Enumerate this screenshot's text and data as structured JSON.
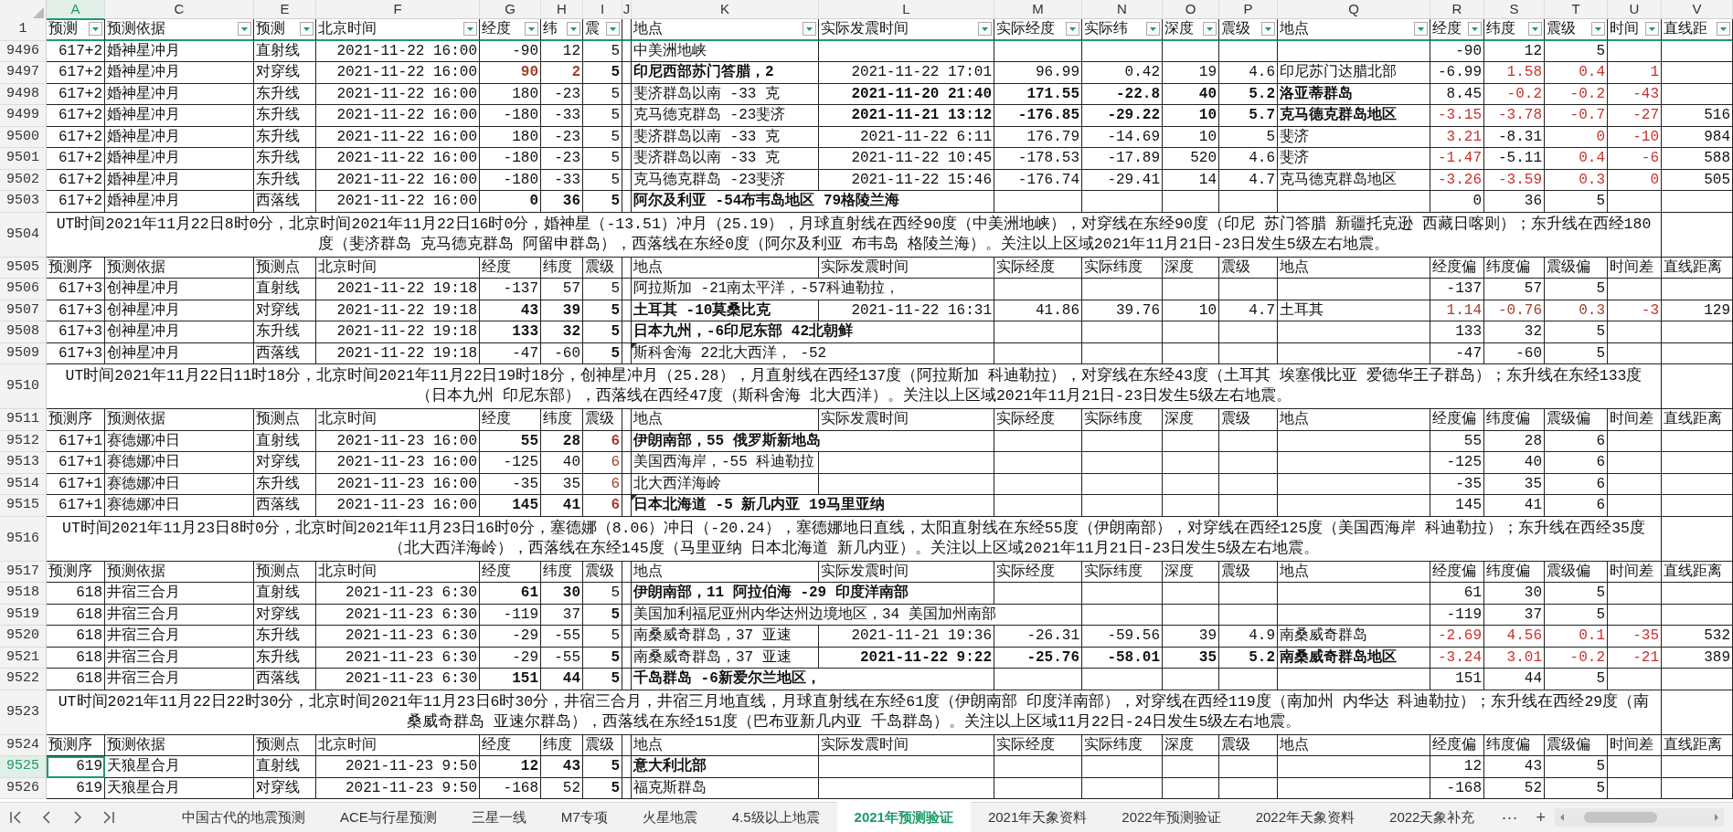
{
  "column_letters": [
    {
      "label": "A",
      "selected": true
    },
    {
      "label": "C",
      "selected": false
    },
    {
      "label": "E",
      "selected": false
    },
    {
      "label": "F",
      "selected": false
    },
    {
      "label": "G",
      "selected": false
    },
    {
      "label": "H",
      "selected": false
    },
    {
      "label": "I",
      "selected": false
    },
    {
      "label": "J",
      "selected": false
    },
    {
      "label": "K",
      "selected": false
    },
    {
      "label": "L",
      "selected": false
    },
    {
      "label": "M",
      "selected": false
    },
    {
      "label": "N",
      "selected": false
    },
    {
      "label": "O",
      "selected": false
    },
    {
      "label": "P",
      "selected": false
    },
    {
      "label": "Q",
      "selected": false
    },
    {
      "label": "R",
      "selected": false
    },
    {
      "label": "S",
      "selected": false
    },
    {
      "label": "T",
      "selected": false
    },
    {
      "label": "U",
      "selected": false
    },
    {
      "label": "V",
      "selected": false
    }
  ],
  "rows": [
    {
      "kind": "filter-header",
      "number": "1",
      "selected": false,
      "cells": {
        "A": "预测",
        "C": "预测依据",
        "E": "预测",
        "F": "北京时间",
        "G": "经度",
        "H": "纬",
        "I": "震",
        "K": "地点",
        "L": "实际发震时间",
        "M": "实际经度",
        "N": "实际纬",
        "O": "深度",
        "P": "震级",
        "Q": "地点",
        "R": "经度",
        "S": "纬度",
        "T": "震级",
        "U": "时间",
        "V": "直线距"
      }
    },
    {
      "kind": "data",
      "number": "9496",
      "selected": false,
      "cells": {
        "A": "617+2",
        "C": "婚神星冲月",
        "E": "直射线",
        "F": "2021-11-22 16:00",
        "G": "-90",
        "H": "12",
        "I": "5",
        "K": "中美洲地峡",
        "R": "-90",
        "S": "12",
        "T": "5"
      }
    },
    {
      "kind": "data",
      "number": "9497",
      "selected": false,
      "cells": {
        "A": "617+2",
        "C": "婚神星冲月",
        "E": "对穿线",
        "F": "2021-11-22 16:00",
        "G": {
          "text": "90",
          "bold": true,
          "color": "#a0402c"
        },
        "H": {
          "text": "2",
          "bold": true,
          "color": "#a0402c"
        },
        "I": {
          "text": "5",
          "bold": true
        },
        "K": {
          "text": "印尼西部苏门答腊，2",
          "bold": true
        },
        "L": "2021-11-22 17:01",
        "M": "96.99",
        "N": "0.42",
        "O": "19",
        "P": "4.6",
        "Q": "印尼苏门达腊北部",
        "R": "-6.99",
        "S": {
          "text": "1.58",
          "color": "#c8322d"
        },
        "T": {
          "text": "0.4",
          "color": "#c8322d"
        },
        "U": {
          "text": "1",
          "color": "#c8322d"
        }
      }
    },
    {
      "kind": "data",
      "number": "9498",
      "selected": false,
      "cells": {
        "A": "617+2",
        "C": "婚神星冲月",
        "E": "东升线",
        "F": "2021-11-22 16:00",
        "G": "180",
        "H": "-23",
        "I": "5",
        "K": "斐济群岛以南 -33 克",
        "L": {
          "text": "2021-11-20 21:40",
          "bold": true
        },
        "M": {
          "text": "171.55",
          "bold": true
        },
        "N": {
          "text": "-22.8",
          "bold": true
        },
        "O": {
          "text": "40",
          "bold": true
        },
        "P": {
          "text": "5.2",
          "bold": true
        },
        "Q": {
          "text": "洛亚蒂群岛",
          "bold": true
        },
        "R": "8.45",
        "S": {
          "text": "-0.2",
          "color": "#c8322d"
        },
        "T": {
          "text": "-0.2",
          "color": "#c8322d"
        },
        "U": {
          "text": "-43",
          "color": "#c8322d"
        }
      }
    },
    {
      "kind": "data",
      "number": "9499",
      "selected": false,
      "cells": {
        "A": "617+2",
        "C": "婚神星冲月",
        "E": "东升线",
        "F": "2021-11-22 16:00",
        "G": "-180",
        "H": "-33",
        "I": "5",
        "K": "克马德克群岛 -23斐济",
        "L": {
          "text": "2021-11-21 13:12",
          "bold": true
        },
        "M": {
          "text": "-176.85",
          "bold": true
        },
        "N": {
          "text": "-29.22",
          "bold": true
        },
        "O": {
          "text": "10",
          "bold": true
        },
        "P": {
          "text": "5.7",
          "bold": true
        },
        "Q": {
          "text": "克马德克群岛地区",
          "bold": true
        },
        "R": {
          "text": "-3.15",
          "color": "#c8322d"
        },
        "S": {
          "text": "-3.78",
          "color": "#c8322d"
        },
        "T": {
          "text": "-0.7",
          "color": "#c8322d"
        },
        "U": {
          "text": "-27",
          "color": "#c8322d"
        },
        "V": "516"
      }
    },
    {
      "kind": "data",
      "number": "9500",
      "selected": false,
      "cells": {
        "A": "617+2",
        "C": "婚神星冲月",
        "E": "东升线",
        "F": "2021-11-22 16:00",
        "G": "180",
        "H": "-23",
        "I": "5",
        "K": "斐济群岛以南 -33 克",
        "L": "2021-11-22 6:11",
        "M": "176.79",
        "N": "-14.69",
        "O": "10",
        "P": "5",
        "Q": "斐济",
        "R": {
          "text": "3.21",
          "color": "#c8322d"
        },
        "S": "-8.31",
        "T": {
          "text": "0",
          "color": "#c8322d"
        },
        "U": {
          "text": "-10",
          "color": "#c8322d"
        },
        "V": "984"
      }
    },
    {
      "kind": "data",
      "number": "9501",
      "selected": false,
      "cells": {
        "A": "617+2",
        "C": "婚神星冲月",
        "E": "东升线",
        "F": "2021-11-22 16:00",
        "G": "-180",
        "H": "-23",
        "I": "5",
        "K": "斐济群岛以南 -33 克",
        "L": "2021-11-22 10:45",
        "M": "-178.53",
        "N": "-17.89",
        "O": "520",
        "P": "4.6",
        "Q": "斐济",
        "R": {
          "text": "-1.47",
          "color": "#c8322d"
        },
        "S": "-5.11",
        "T": {
          "text": "0.4",
          "color": "#c8322d"
        },
        "U": {
          "text": "-6",
          "color": "#c8322d"
        },
        "V": "588"
      }
    },
    {
      "kind": "data",
      "number": "9502",
      "selected": false,
      "cells": {
        "A": "617+2",
        "C": "婚神星冲月",
        "E": "东升线",
        "F": "2021-11-22 16:00",
        "G": "-180",
        "H": "-33",
        "I": "5",
        "K": "克马德克群岛 -23斐济",
        "L": "2021-11-22 15:46",
        "M": "-176.74",
        "N": "-29.41",
        "O": "14",
        "P": "4.7",
        "Q": "克马德克群岛地区",
        "R": {
          "text": "-3.26",
          "color": "#c8322d"
        },
        "S": {
          "text": "-3.59",
          "color": "#c8322d"
        },
        "T": {
          "text": "0.3",
          "color": "#c8322d"
        },
        "U": {
          "text": "0",
          "color": "#c8322d"
        },
        "V": "505"
      }
    },
    {
      "kind": "data",
      "number": "9503",
      "selected": false,
      "cells": {
        "A": "617+2",
        "C": "婚神星冲月",
        "E": "西落线",
        "F": "2021-11-22 16:00",
        "G": {
          "text": "0",
          "bold": true
        },
        "H": {
          "text": "36",
          "bold": true
        },
        "I": {
          "text": "5",
          "bold": true
        },
        "K": {
          "text": "阿尔及利亚 -54布韦岛地区 79格陵兰海",
          "bold": true
        },
        "R": "0",
        "S": "36",
        "T": "5"
      }
    },
    {
      "kind": "note",
      "number": "9504",
      "selected": false,
      "text": "UT时间2021年11月22日8时0分，北京时间2021年11月22日16时0分，婚神星（-13.51）冲月（25.19），月球直射线在西经90度（中美洲地峡），对穿线在东经90度（印尼 苏门答腊 新疆托克逊 西藏日喀则）；东升线在西经180度（斐济群岛 克马德克群岛 阿留申群岛），西落线在东经0度（阿尔及利亚 布韦岛 格陵兰海）。关注以上区域2021年11月21日-23日发生5级左右地震。"
    },
    {
      "kind": "header",
      "number": "9505",
      "selected": false,
      "cells": {
        "A": "预测序",
        "C": "预测依据",
        "E": "预测点",
        "F": "北京时间",
        "G": "经度",
        "H": "纬度",
        "I": "震级",
        "K": "地点",
        "L": "实际发震时间",
        "M": "实际经度",
        "N": "实际纬度",
        "O": "深度",
        "P": "震级",
        "Q": "地点",
        "R": "经度偏",
        "S": "纬度偏",
        "T": "震级偏",
        "U": "时间差",
        "V": "直线距离"
      }
    },
    {
      "kind": "data",
      "number": "9506",
      "selected": false,
      "cells": {
        "A": "617+3",
        "C": "创神星冲月",
        "E": "直射线",
        "F": "2021-11-22 19:18",
        "G": "-137",
        "H": "57",
        "I": "5",
        "K": "阿拉斯加 -21南太平洋，-57科迪勒拉，",
        "R": "-137",
        "S": "57",
        "T": "5"
      }
    },
    {
      "kind": "data",
      "number": "9507",
      "selected": false,
      "cells": {
        "A": "617+3",
        "C": "创神星冲月",
        "E": "对穿线",
        "F": "2021-11-22 19:18",
        "G": {
          "text": "43",
          "bold": true
        },
        "H": {
          "text": "39",
          "bold": true
        },
        "I": {
          "text": "5",
          "bold": true
        },
        "K": {
          "text": "土耳其 -10莫桑比克",
          "bold": true
        },
        "L": "2021-11-22 16:31",
        "M": "41.86",
        "N": "39.76",
        "O": "10",
        "P": "4.7",
        "Q": "土耳其",
        "R": {
          "text": "1.14",
          "color": "#a0402c"
        },
        "S": {
          "text": "-0.76",
          "color": "#a0402c"
        },
        "T": {
          "text": "0.3",
          "color": "#a0402c"
        },
        "U": {
          "text": "-3",
          "color": "#c8322d"
        },
        "V": "129"
      }
    },
    {
      "kind": "data",
      "number": "9508",
      "selected": false,
      "cells": {
        "A": "617+3",
        "C": "创神星冲月",
        "E": "东升线",
        "F": "2021-11-22 19:18",
        "G": {
          "text": "133",
          "bold": true
        },
        "H": {
          "text": "32",
          "bold": true
        },
        "I": {
          "text": "5",
          "bold": true
        },
        "K": {
          "text": "日本九州，-6印尼东部 42北朝鲜",
          "bold": true
        },
        "R": "133",
        "S": "32",
        "T": "5"
      }
    },
    {
      "kind": "data",
      "number": "9509",
      "selected": false,
      "cells": {
        "A": "617+3",
        "C": "创神星冲月",
        "E": "西落线",
        "F": "2021-11-22 19:18",
        "G": "-47",
        "H": "-60",
        "I": {
          "text": "5",
          "bold": true
        },
        "K": {
          "text": "斯科舍海 22北大西洋， -52",
          "comment": true
        },
        "R": "-47",
        "S": "-60",
        "T": "5"
      }
    },
    {
      "kind": "note",
      "number": "9510",
      "selected": false,
      "text": "UT时间2021年11月22日11时18分，北京时间2021年11月22日19时18分，创神星冲月（25.28），月直射线在西经137度（阿拉斯加 科迪勒拉），对穿线在东经43度（土耳其 埃塞俄比亚 爱德华王子群岛）；东升线在东经133度（日本九州 印尼东部），西落线在西经47度（斯科舍海 北大西洋）。关注以上区域2021年11月21日-23日发生5级左右地震。"
    },
    {
      "kind": "header",
      "number": "9511",
      "selected": false,
      "cells": {
        "A": "预测序",
        "C": "预测依据",
        "E": "预测点",
        "F": "北京时间",
        "G": "经度",
        "H": "纬度",
        "I": "震级",
        "K": "地点",
        "L": "实际发震时间",
        "M": "实际经度",
        "N": "实际纬度",
        "O": "深度",
        "P": "震级",
        "Q": "地点",
        "R": "经度偏",
        "S": "纬度偏",
        "T": "震级偏",
        "U": "时间差",
        "V": "直线距离"
      }
    },
    {
      "kind": "data",
      "number": "9512",
      "selected": false,
      "cells": {
        "A": "617+1",
        "C": "赛德娜冲日",
        "E": "直射线",
        "F": "2021-11-23 16:00",
        "G": {
          "text": "55",
          "bold": true
        },
        "H": {
          "text": "28",
          "bold": true
        },
        "I": {
          "text": "6",
          "bold": true,
          "color": "#a0402c"
        },
        "K": {
          "text": "伊朗南部，55 俄罗斯新地岛",
          "bold": true
        },
        "R": "55",
        "S": "28",
        "T": "6"
      }
    },
    {
      "kind": "data",
      "number": "9513",
      "selected": false,
      "cells": {
        "A": "617+1",
        "C": "赛德娜冲日",
        "E": "对穿线",
        "F": "2021-11-23 16:00",
        "G": "-125",
        "H": "40",
        "I": {
          "text": "6",
          "color": "#a0402c"
        },
        "K": "美国西海岸，-55 科迪勒拉",
        "R": "-125",
        "S": "40",
        "T": "6"
      }
    },
    {
      "kind": "data",
      "number": "9514",
      "selected": false,
      "cells": {
        "A": "617+1",
        "C": "赛德娜冲日",
        "E": "东升线",
        "F": "2021-11-23 16:00",
        "G": "-35",
        "H": "35",
        "I": {
          "text": "6",
          "color": "#a0402c"
        },
        "K": "北大西洋海岭",
        "R": "-35",
        "S": "35",
        "T": "6"
      }
    },
    {
      "kind": "data",
      "number": "9515",
      "selected": false,
      "cells": {
        "A": "617+1",
        "C": "赛德娜冲日",
        "E": "西落线",
        "F": "2021-11-23 16:00",
        "G": {
          "text": "145",
          "bold": true
        },
        "H": {
          "text": "41",
          "bold": true
        },
        "I": {
          "text": "6",
          "bold": true,
          "color": "#a0402c"
        },
        "K": {
          "text": "日本北海道 -5 新几内亚 19马里亚纳",
          "bold": true,
          "comment": true
        },
        "R": "145",
        "S": "41",
        "T": "6"
      }
    },
    {
      "kind": "note",
      "number": "9516",
      "selected": false,
      "text": "UT时间2021年11月23日8时0分，北京时间2021年11月23日16时0分，塞德娜（8.06）冲日（-20.24），塞德娜地日直线，太阳直射线在东经55度（伊朗南部），对穿线在西经125度（美国西海岸 科迪勒拉）；东升线在西经35度（北大西洋海岭），西落线在东经145度（马里亚纳 日本北海道 新几内亚）。关注以上区域2021年11月21日-23日发生5级左右地震。"
    },
    {
      "kind": "header",
      "number": "9517",
      "selected": false,
      "cells": {
        "A": "预测序",
        "C": "预测依据",
        "E": "预测点",
        "F": "北京时间",
        "G": "经度",
        "H": "纬度",
        "I": "震级",
        "K": "地点",
        "L": "实际发震时间",
        "M": "实际经度",
        "N": "实际纬度",
        "O": "深度",
        "P": "震级",
        "Q": "地点",
        "R": "经度偏",
        "S": "纬度偏",
        "T": "震级偏",
        "U": "时间差",
        "V": "直线距离"
      }
    },
    {
      "kind": "data",
      "number": "9518",
      "selected": false,
      "cells": {
        "A": "618",
        "C": "井宿三合月",
        "E": "直射线",
        "F": "2021-11-23 6:30",
        "G": {
          "text": "61",
          "bold": true
        },
        "H": {
          "text": "30",
          "bold": true
        },
        "I": "5",
        "K": {
          "text": "伊朗南部，11 阿拉伯海 -29 印度洋南部",
          "bold": true
        },
        "R": "61",
        "S": "30",
        "T": "5"
      }
    },
    {
      "kind": "data",
      "number": "9519",
      "selected": false,
      "cells": {
        "A": "618",
        "C": "井宿三合月",
        "E": "对穿线",
        "F": "2021-11-23 6:30",
        "G": "-119",
        "H": "37",
        "I": {
          "text": "5",
          "bold": true
        },
        "K": "美国加利福尼亚州内华达州边境地区，34 美国加州南部",
        "R": "-119",
        "S": "37",
        "T": "5"
      }
    },
    {
      "kind": "data",
      "number": "9520",
      "selected": false,
      "cells": {
        "A": "618",
        "C": "井宿三合月",
        "E": "东升线",
        "F": "2021-11-23 6:30",
        "G": "-29",
        "H": "-55",
        "I": "5",
        "K": "南桑威奇群岛，37 亚速",
        "L": "2021-11-21 19:36",
        "M": "-26.31",
        "N": "-59.56",
        "O": "39",
        "P": "4.9",
        "Q": "南桑威奇群岛",
        "R": {
          "text": "-2.69",
          "color": "#c8322d"
        },
        "S": {
          "text": "4.56",
          "color": "#c8322d"
        },
        "T": {
          "text": "0.1",
          "color": "#c8322d"
        },
        "U": {
          "text": "-35",
          "color": "#c8322d"
        },
        "V": "532"
      }
    },
    {
      "kind": "data",
      "number": "9521",
      "selected": false,
      "cells": {
        "A": "618",
        "C": "井宿三合月",
        "E": "东升线",
        "F": "2021-11-23 6:30",
        "G": "-29",
        "H": "-55",
        "I": {
          "text": "5",
          "bold": true
        },
        "K": "南桑威奇群岛，37 亚速",
        "L": {
          "text": "2021-11-22 9:22",
          "bold": true
        },
        "M": {
          "text": "-25.76",
          "bold": true
        },
        "N": {
          "text": "-58.01",
          "bold": true
        },
        "O": {
          "text": "35",
          "bold": true
        },
        "P": {
          "text": "5.2",
          "bold": true
        },
        "Q": {
          "text": "南桑威奇群岛地区",
          "bold": true
        },
        "R": {
          "text": "-3.24",
          "color": "#c8322d"
        },
        "S": {
          "text": "3.01",
          "color": "#c8322d"
        },
        "T": {
          "text": "-0.2",
          "color": "#c8322d"
        },
        "U": {
          "text": "-21",
          "color": "#c8322d"
        },
        "V": "389"
      }
    },
    {
      "kind": "data",
      "number": "9522",
      "selected": false,
      "cells": {
        "A": "618",
        "C": "井宿三合月",
        "E": "西落线",
        "F": "2021-11-23 6:30",
        "G": {
          "text": "151",
          "bold": true
        },
        "H": {
          "text": "44",
          "bold": true
        },
        "I": {
          "text": "5",
          "bold": true
        },
        "K": {
          "text": "千岛群岛 -6新爱尔兰地区，",
          "bold": true
        },
        "R": "151",
        "S": "44",
        "T": "5"
      }
    },
    {
      "kind": "note",
      "number": "9523",
      "selected": false,
      "text": "UT时间2021年11月22日22时30分，北京时间2021年11月23日6时30分，井宿三合月，井宿三月地直线，月球直射线在东经61度（伊朗南部 印度洋南部），对穿线在西经119度（南加州 内华达 科迪勒拉）；东升线在西经29度（南桑威奇群岛 亚速尔群岛），西落线在东经151度（巴布亚新几内亚 千岛群岛）。关注以上区域11月22日-24日发生5级左右地震。"
    },
    {
      "kind": "header",
      "number": "9524",
      "selected": false,
      "cells": {
        "A": "预测序",
        "C": "预测依据",
        "E": "预测点",
        "F": "北京时间",
        "G": "经度",
        "H": "纬度",
        "I": "震级",
        "K": "地点",
        "L": "实际发震时间",
        "M": "实际经度",
        "N": "实际纬度",
        "O": "深度",
        "P": "震级",
        "Q": "地点",
        "R": "经度偏",
        "S": "纬度偏",
        "T": "震级偏",
        "U": "时间差",
        "V": "直线距离"
      }
    },
    {
      "kind": "data",
      "number": "9525",
      "selected": true,
      "cells": {
        "A": "619",
        "C": "天狼星合月",
        "E": "直射线",
        "F": "2021-11-23 9:50",
        "G": {
          "text": "12",
          "bold": true
        },
        "H": {
          "text": "43",
          "bold": true
        },
        "I": {
          "text": "5",
          "bold": true
        },
        "K": {
          "text": "意大利北部",
          "bold": true
        },
        "R": "12",
        "S": "43",
        "T": "5"
      }
    },
    {
      "kind": "data",
      "number": "9526",
      "selected": false,
      "cells": {
        "A": "619",
        "C": "天狼星合月",
        "E": "对穿线",
        "F": "2021-11-23 9:50",
        "G": "-168",
        "H": "52",
        "I": {
          "text": "5",
          "bold": true
        },
        "K": "福克斯群岛",
        "R": "-168",
        "S": "52",
        "T": "5"
      }
    }
  ],
  "sheet_tabs": [
    {
      "label": "中国古代的地震预测",
      "selected": false
    },
    {
      "label": "ACE与行星预测",
      "selected": false
    },
    {
      "label": "三星一线",
      "selected": false
    },
    {
      "label": "M7专项",
      "selected": false
    },
    {
      "label": "火星地震",
      "selected": false
    },
    {
      "label": "4.5级以上地震",
      "selected": false
    },
    {
      "label": "2021年预测验证",
      "selected": true
    },
    {
      "label": "2021年天象资料",
      "selected": false
    },
    {
      "label": "2022年预测验证",
      "selected": false
    },
    {
      "label": "2022年天象资料",
      "selected": false
    },
    {
      "label": "2022天象补充",
      "selected": false
    }
  ],
  "tab_bar": {
    "more": "···",
    "add": "+"
  }
}
